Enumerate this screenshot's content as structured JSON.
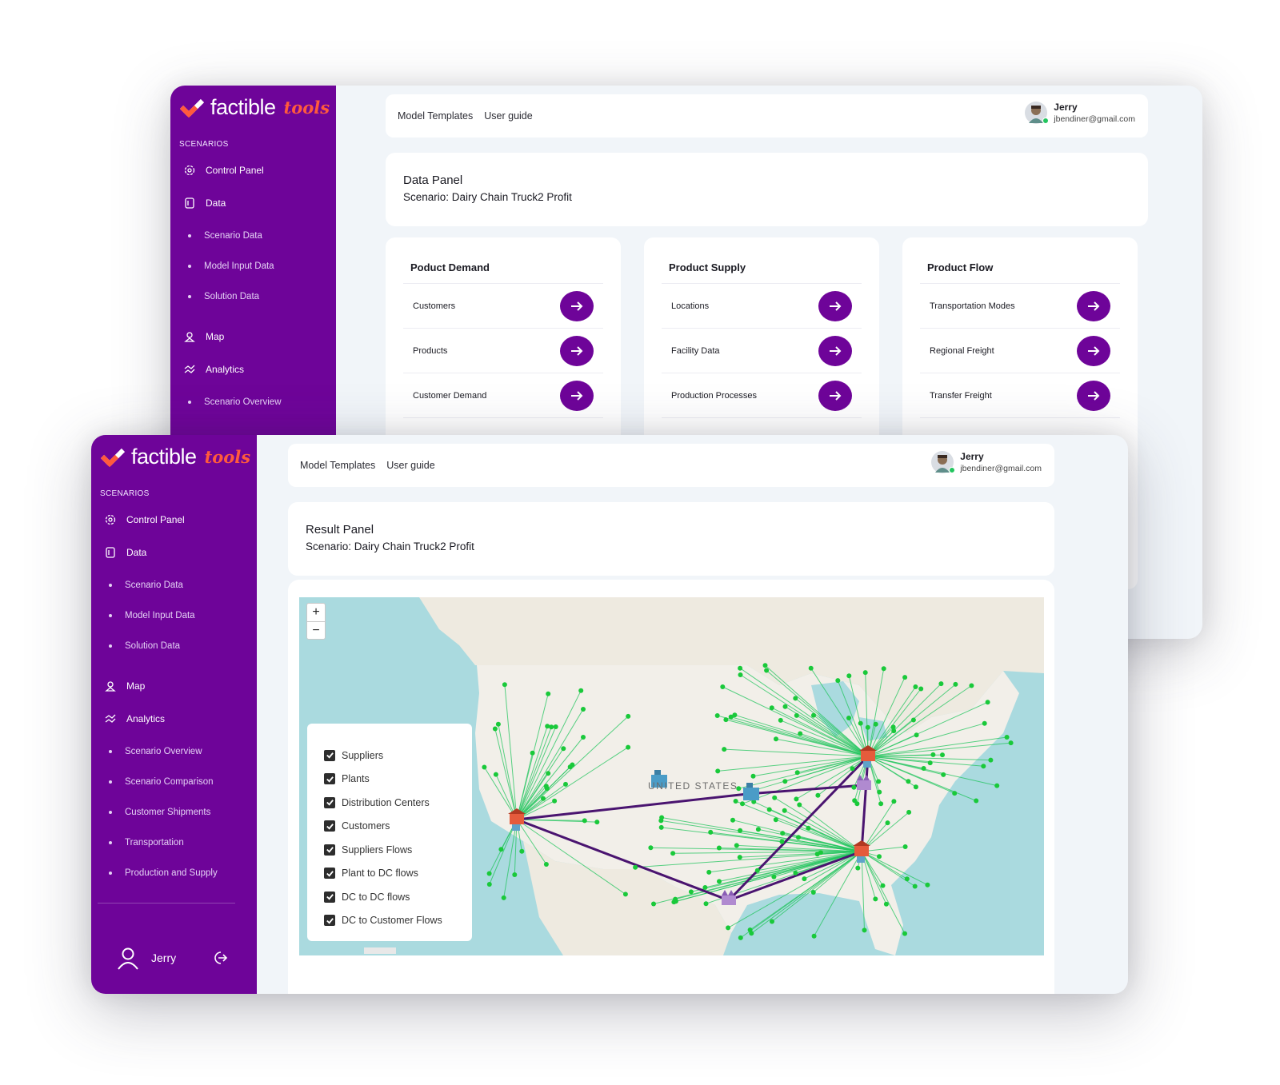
{
  "app": {
    "brand_main": "factible",
    "brand_sub": "tools",
    "brand_color": "#6e0499",
    "accent_color": "#ff5a3c"
  },
  "header": {
    "links": [
      "Model Templates",
      "User guide"
    ],
    "user_name": "Jerry",
    "user_email": "jbendiner@gmail.com"
  },
  "sidebar": {
    "section_label": "SCENARIOS",
    "items": {
      "control_panel": "Control Panel",
      "data": "Data",
      "scenario_data": "Scenario Data",
      "model_input_data": "Model Input Data",
      "solution_data": "Solution Data",
      "map": "Map",
      "analytics": "Analytics",
      "scenario_overview": "Scenario Overview",
      "scenario_comparison": "Scenario Comparison",
      "customer_shipments": "Customer Shipments",
      "transportation": "Transportation",
      "production_and_supply": "Production and Supply"
    },
    "footer_user": "Jerry"
  },
  "data_panel": {
    "title": "Data Panel",
    "scenario": "Scenario: Dairy Chain Truck2 Profit",
    "cards": [
      {
        "title": "Poduct Demand",
        "rows": [
          "Customers",
          "Products",
          "Customer Demand"
        ]
      },
      {
        "title": "Product Supply",
        "rows": [
          "Locations",
          "Facility Data",
          "Production Processes"
        ]
      },
      {
        "title": "Product Flow",
        "rows": [
          "Transportation Modes",
          "Regional Freight",
          "Transfer Freight"
        ]
      }
    ]
  },
  "result_panel": {
    "title": "Result Panel",
    "scenario": "Scenario: Dairy Chain Truck2 Profit",
    "map": {
      "zoom_in": "+",
      "zoom_out": "−",
      "country_label": "UNITED STATES",
      "flow_color": "#22c55e",
      "route_color": "#4a1470",
      "legend": [
        "Suppliers",
        "Plants",
        "Distribution Centers",
        "Customers",
        "Suppliers Flows",
        "Plant to DC flows",
        "DC to DC flows",
        "DC to Customer Flows"
      ]
    }
  }
}
